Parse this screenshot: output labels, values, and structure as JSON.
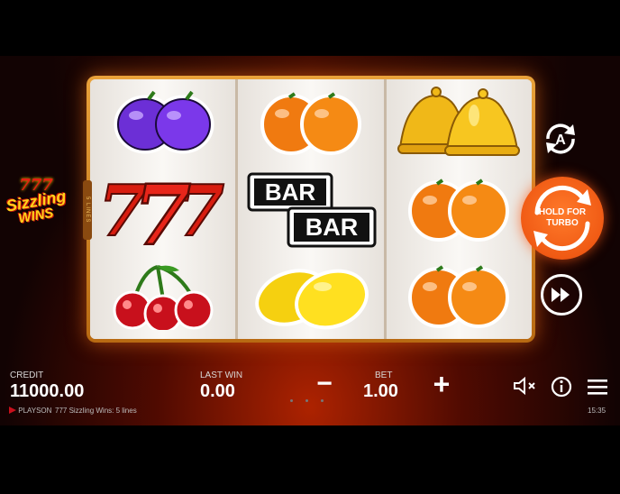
{
  "game": {
    "logo_line_top": "777",
    "logo_line_1": "Sizzling",
    "logo_line_2": "WINS",
    "lines_tab_label": "5 LINES"
  },
  "reels": [
    [
      "plum",
      "seven",
      "cherry"
    ],
    [
      "orange",
      "bar",
      "lemon"
    ],
    [
      "bell",
      "orange",
      "orange"
    ]
  ],
  "symbols": {
    "bar_text": "BAR",
    "seven_text": "7"
  },
  "controls": {
    "autoplay_letter": "A",
    "spin_label_line1": "HOLD FOR",
    "spin_label_line2": "TURBO"
  },
  "bottom": {
    "credit_label": "CREDIT",
    "credit_value": "11000.00",
    "lastwin_label": "LAST WIN",
    "lastwin_value": "0.00",
    "bet_label": "BET",
    "bet_value": "1.00",
    "minus": "−",
    "plus": "+"
  },
  "footer": {
    "brand": "PLAYSON",
    "game_info": "777 Sizzling Wins: 5 lines",
    "clock": "15:35"
  },
  "icons": [
    "autoplay-icon",
    "spin-arrows-icon",
    "skip-icon",
    "mute-icon",
    "info-icon",
    "menu-icon",
    "playson-logo-icon"
  ],
  "colors": {
    "spin": "#f05a14",
    "frame": "#d98a24",
    "reel_bg": "#f3efe9"
  }
}
